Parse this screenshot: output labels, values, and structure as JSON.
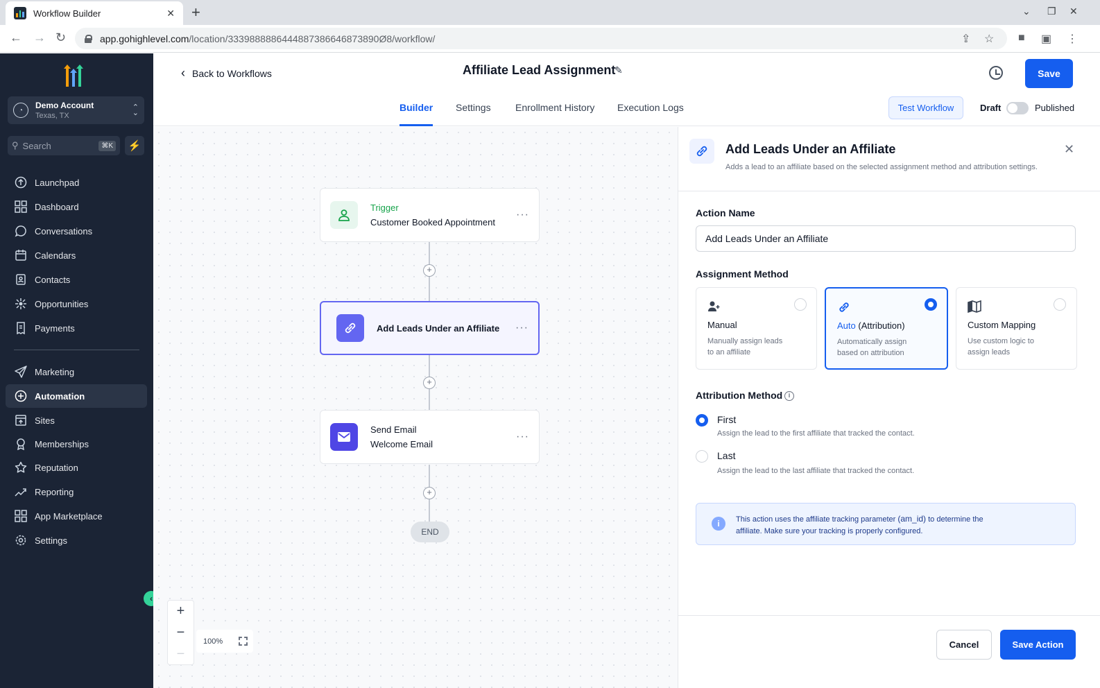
{
  "browser": {
    "tab_title": "Workflow Builder",
    "url_host": "app.gohighlevel.com",
    "url_path": "/location/3339888886444887386646873890Ø8/workflow/"
  },
  "sidebar": {
    "account_name": "Demo Account",
    "account_location": "Texas, TX",
    "search_placeholder": "Search",
    "search_shortcut": "⌘K",
    "items": [
      {
        "label": "Launchpad",
        "icon": "launchpad-icon"
      },
      {
        "label": "Dashboard",
        "icon": "dashboard-icon"
      },
      {
        "label": "Conversations",
        "icon": "chat-icon"
      },
      {
        "label": "Calendars",
        "icon": "calendar-icon"
      },
      {
        "label": "Contacts",
        "icon": "contacts-icon"
      },
      {
        "label": "Opportunities",
        "icon": "opportunities-icon"
      },
      {
        "label": "Payments",
        "icon": "payments-icon"
      },
      {
        "label": "Marketing",
        "icon": "send-icon"
      },
      {
        "label": "Automation",
        "icon": "automation-icon"
      },
      {
        "label": "Sites",
        "icon": "sites-icon"
      },
      {
        "label": "Memberships",
        "icon": "badge-icon"
      },
      {
        "label": "Reputation",
        "icon": "star-icon"
      },
      {
        "label": "Reporting",
        "icon": "trend-icon"
      },
      {
        "label": "App Marketplace",
        "icon": "grid-icon"
      },
      {
        "label": "Settings",
        "icon": "gear-icon"
      }
    ],
    "active_item": "Automation"
  },
  "header": {
    "back_label": "Back to Workflows",
    "title": "Affiliate Lead Assignment",
    "save_label": "Save",
    "tabs": [
      "Builder",
      "Settings",
      "Enrollment History",
      "Execution Logs"
    ],
    "active_tab": "Builder",
    "test_label": "Test Workflow",
    "draft_label": "Draft",
    "published_label": "Published"
  },
  "canvas": {
    "trigger": {
      "title": "Trigger",
      "subtitle": "Customer Booked Appointment"
    },
    "action": {
      "title": "Add Leads Under an Affiliate"
    },
    "email": {
      "title": "Send Email",
      "subtitle": "Welcome Email"
    },
    "end_label": "END",
    "zoom": "100%"
  },
  "panel": {
    "title": "Add Leads Under an Affiliate",
    "description": "Adds a lead to an affiliate based on the selected assignment method and attribution settings.",
    "action_name_label": "Action Name",
    "action_name_value": "Add Leads Under an Affiliate",
    "assignment_label": "Assignment Method",
    "methods": [
      {
        "title": "Manual",
        "desc": "Manually assign leads to an affiliate",
        "selected": false
      },
      {
        "title": "Auto",
        "title_suffix": "(Attribution)",
        "desc": "Automatically assign based on attribution",
        "selected": true
      },
      {
        "title": "Custom Mapping",
        "desc": "Use custom logic to assign leads",
        "selected": false
      }
    ],
    "attribution_label": "Attribution Method",
    "options": [
      {
        "label": "First",
        "desc": "Assign the lead to the first affiliate that tracked the contact.",
        "selected": true
      },
      {
        "label": "Last",
        "desc": "Assign the lead to the last affiliate that tracked the contact.",
        "selected": false
      }
    ],
    "note_pre": "This action uses the affiliate tracking parameter",
    "note_code": "(am_id)",
    "note_post": "to determine the affiliate. Make sure your tracking is properly configured.",
    "cancel_label": "Cancel",
    "save_action_label": "Save Action"
  },
  "colors": {
    "accent": "#155eef",
    "sidebar_bg": "#1b2435",
    "success": "#34d399"
  }
}
